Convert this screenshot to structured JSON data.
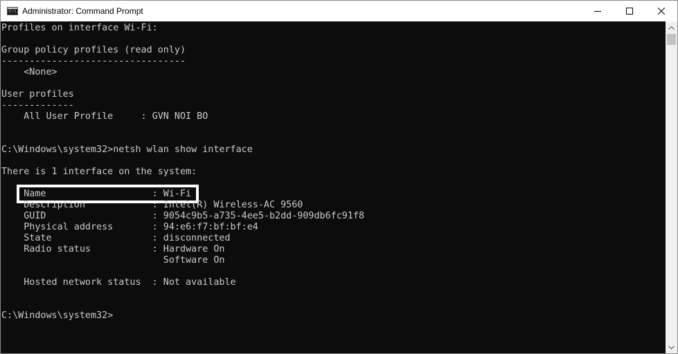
{
  "window": {
    "title": "Administrator: Command Prompt",
    "icon": "cmd-icon",
    "icon_glyph": "C:\\"
  },
  "caption_buttons": [
    {
      "name": "minimize",
      "icon": "minimize-icon"
    },
    {
      "name": "maximize",
      "icon": "maximize-icon"
    },
    {
      "name": "close",
      "icon": "close-icon"
    }
  ],
  "terminal": {
    "text_color": "#cccccc",
    "background": "#0c0c0c",
    "lines": [
      "Profiles on interface Wi-Fi:",
      "",
      "Group policy profiles (read only)",
      "---------------------------------",
      "    <None>",
      "",
      "User profiles",
      "-------------",
      "    All User Profile     : GVN NOI BO",
      "",
      "",
      "C:\\Windows\\system32>netsh wlan show interface",
      "",
      "There is 1 interface on the system:",
      "",
      "    Name                   : Wi-Fi",
      "    Description            : Intel(R) Wireless-AC 9560",
      "    GUID                   : 9054c9b5-a735-4ee5-b2dd-909db6fc91f8",
      "    Physical address       : 94:e6:f7:bf:bf:e4",
      "    State                  : disconnected",
      "    Radio status           : Hardware On",
      "                             Software On",
      "",
      "    Hosted network status  : Not available",
      "",
      "",
      "C:\\Windows\\system32>"
    ]
  },
  "highlight": {
    "target": "Name : Wi-Fi",
    "color": "#ffffff"
  }
}
